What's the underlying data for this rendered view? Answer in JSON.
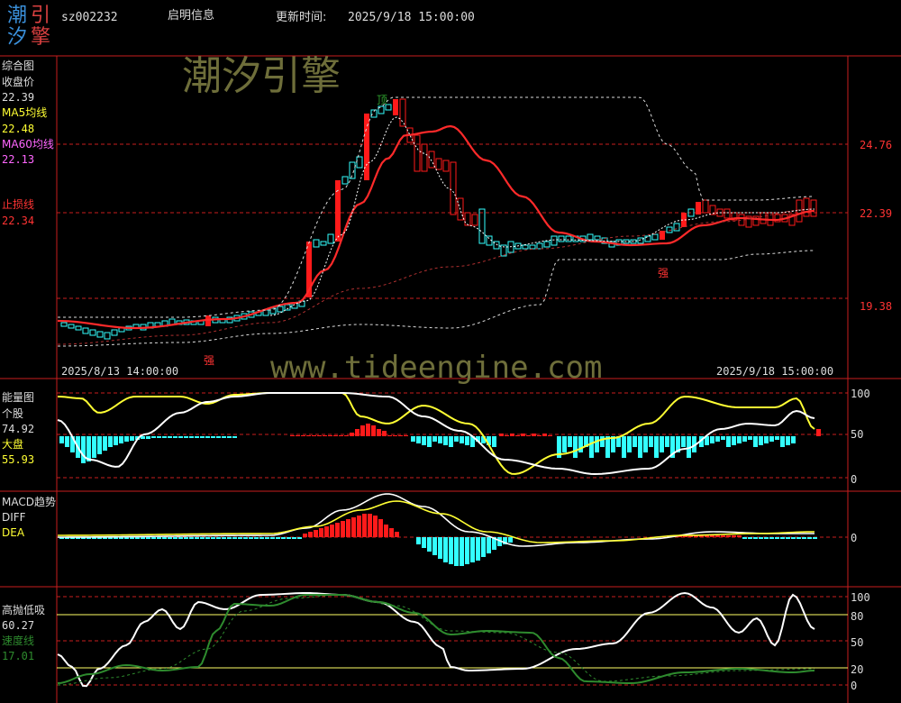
{
  "logo": {
    "chars": [
      "潮",
      "引",
      "汐",
      "擎"
    ]
  },
  "header": {
    "code": "sz002232",
    "name": "启明信息",
    "update_label": "更新时间:",
    "update_value": "2025/9/18 15:00:00"
  },
  "watermarks": {
    "brand": "潮汐引擎",
    "url": "www.tideengine.com"
  },
  "main": {
    "title": "综合图",
    "close_label": "收盘价",
    "close_value": "22.39",
    "ma5_label": "MA5均线",
    "ma5_value": "22.48",
    "ma60_label": "MA60均线",
    "ma60_value": "22.13",
    "stop_label": "止损线",
    "stop_value": "22.34",
    "price_axis": [
      "24.76",
      "22.39",
      "19.38"
    ],
    "date_start": "2025/8/13 14:00:00",
    "date_end": "2025/9/18 15:00:00",
    "annot_top": "顶",
    "annot_q": "强"
  },
  "energy": {
    "title": "能量图",
    "stock_label": "个股",
    "stock_value": "74.92",
    "market_label": "大盘",
    "market_value": "55.93",
    "axis": [
      "100",
      "50",
      "0"
    ]
  },
  "macd": {
    "title": "MACD趋势",
    "diff_label": "DIFF",
    "dea_label": "DEA",
    "axis": [
      "0"
    ]
  },
  "hilo": {
    "title": "高抛低吸",
    "value": "60.27",
    "speed_label": "速度线",
    "speed_value": "17.01",
    "axis": [
      "100",
      "80",
      "50",
      "20",
      "0"
    ]
  },
  "colors": {
    "up": "#ff1a1a",
    "down": "#33ffff",
    "ma5": "#ffffff",
    "ma60": "#ff2a2a",
    "yellow": "#ffff33",
    "green": "#2e8b2e",
    "grid": "#c81e1e"
  }
}
